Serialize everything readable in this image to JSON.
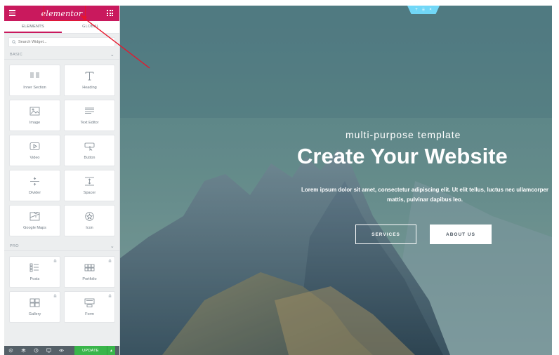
{
  "header": {
    "logo_text": "elementor",
    "brand_color": "#c9195d"
  },
  "tabs": [
    {
      "label": "ELEMENTS",
      "active": true
    },
    {
      "label": "GLOBAL",
      "active": false
    }
  ],
  "search": {
    "placeholder": "Search Widget..."
  },
  "sections": {
    "basic": {
      "title": "BASIC",
      "widgets": [
        {
          "label": "Inner Section",
          "icon": "inner-section-icon"
        },
        {
          "label": "Heading",
          "icon": "heading-icon"
        },
        {
          "label": "Image",
          "icon": "image-icon"
        },
        {
          "label": "Text Editor",
          "icon": "text-editor-icon"
        },
        {
          "label": "Video",
          "icon": "video-icon"
        },
        {
          "label": "Button",
          "icon": "button-icon"
        },
        {
          "label": "Divider",
          "icon": "divider-icon"
        },
        {
          "label": "Spacer",
          "icon": "spacer-icon"
        },
        {
          "label": "Google Maps",
          "icon": "google-maps-icon"
        },
        {
          "label": "Icon",
          "icon": "star-icon"
        }
      ]
    },
    "pro": {
      "title": "PRO",
      "widgets": [
        {
          "label": "Posts",
          "icon": "posts-icon",
          "locked": true
        },
        {
          "label": "Portfolio",
          "icon": "portfolio-icon",
          "locked": true
        },
        {
          "label": "Gallery",
          "icon": "gallery-icon",
          "locked": true
        },
        {
          "label": "Form",
          "icon": "form-icon",
          "locked": true
        }
      ]
    }
  },
  "footer": {
    "update_label": "UPDATE",
    "icons": [
      "gear-icon",
      "layers-icon",
      "history-icon",
      "responsive-icon",
      "eye-icon"
    ]
  },
  "preview": {
    "section_handle_icons": [
      "plus-icon",
      "move-icon",
      "close-icon"
    ],
    "subtitle": "multi-purpose template",
    "title": "Create Your Website",
    "text": "Lorem ipsum dolor sit amet, consectetur adipiscing elit. Ut elit tellus, luctus nec ullamcorper mattis, pulvinar dapibus leo.",
    "button_services": "SERVICES",
    "button_about": "ABOUT US"
  },
  "colors": {
    "handle": "#71d7f7",
    "update_button": "#39b54a",
    "annotation": "#e8162b"
  }
}
